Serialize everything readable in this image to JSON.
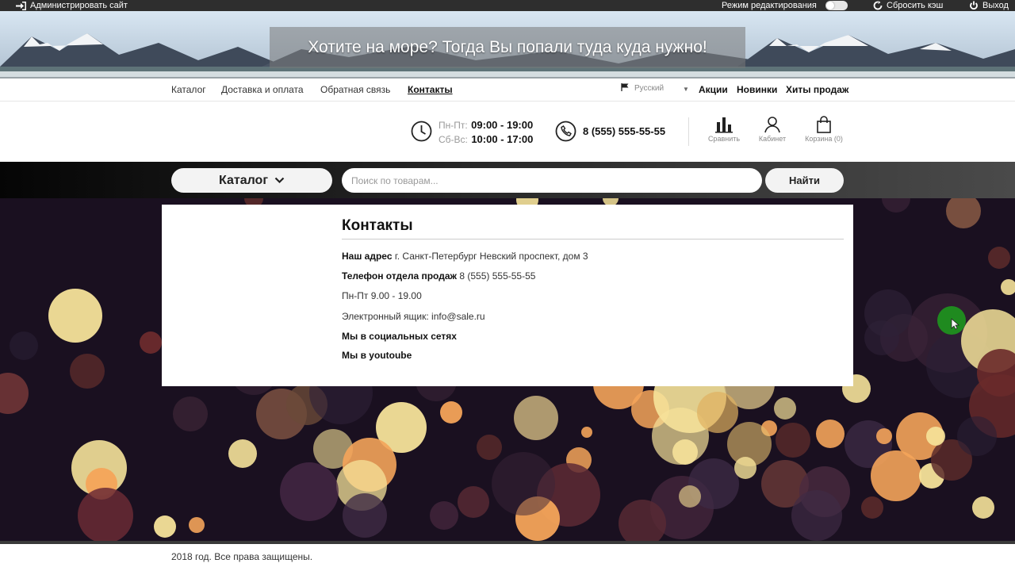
{
  "admin_bar": {
    "admin_site_label": "Администрировать сайт",
    "edit_mode_label": "Режим редактирования",
    "reset_cache_label": "Сбросить кэш",
    "logout_label": "Выход"
  },
  "banner": {
    "title": "Хотите на море? Тогда Вы попали туда куда нужно!"
  },
  "top_nav": {
    "links": [
      "Каталог",
      "Доставка и оплата",
      "Обратная связь",
      "Контакты"
    ],
    "active": "Контакты",
    "language": "Русский",
    "right_links": [
      "Акции",
      "Новинки",
      "Хиты продаж"
    ]
  },
  "header": {
    "weekdays_label": "Пн-Пт:",
    "weekdays_time": "09:00 - 19:00",
    "weekend_label": "Сб-Вс:",
    "weekend_time": "10:00 - 17:00",
    "phone": "8 (555) 555-55-55",
    "compare_label": "Сравнить",
    "cabinet_label": "Кабинет",
    "cart_label": "Корзина (0)"
  },
  "search": {
    "catalog_label": "Каталог",
    "placeholder": "Поиск по товарам...",
    "button_label": "Найти"
  },
  "contacts": {
    "title": "Контакты",
    "address_label": "Наш адрес",
    "address_value": " г. Санкт-Петербург Невский проспект, дом 3",
    "phone_label": "Телефон отдела продаж",
    "phone_value": " 8 (555) 555-55-55",
    "hours": "Пн-Пт 9.00 - 19.00",
    "email": "Электронный ящик: info@sale.ru",
    "social": "Мы в социальных сетях",
    "youtube": "Мы в youtoube"
  },
  "footer": {
    "copyright": "2018 год. Все права защищены."
  },
  "colors": {
    "admin_bar": "#2e2e2e",
    "search_bar": "#1a1a1a",
    "bokeh_bg": "#1a1020",
    "accent_green": "#1f8a1f"
  }
}
